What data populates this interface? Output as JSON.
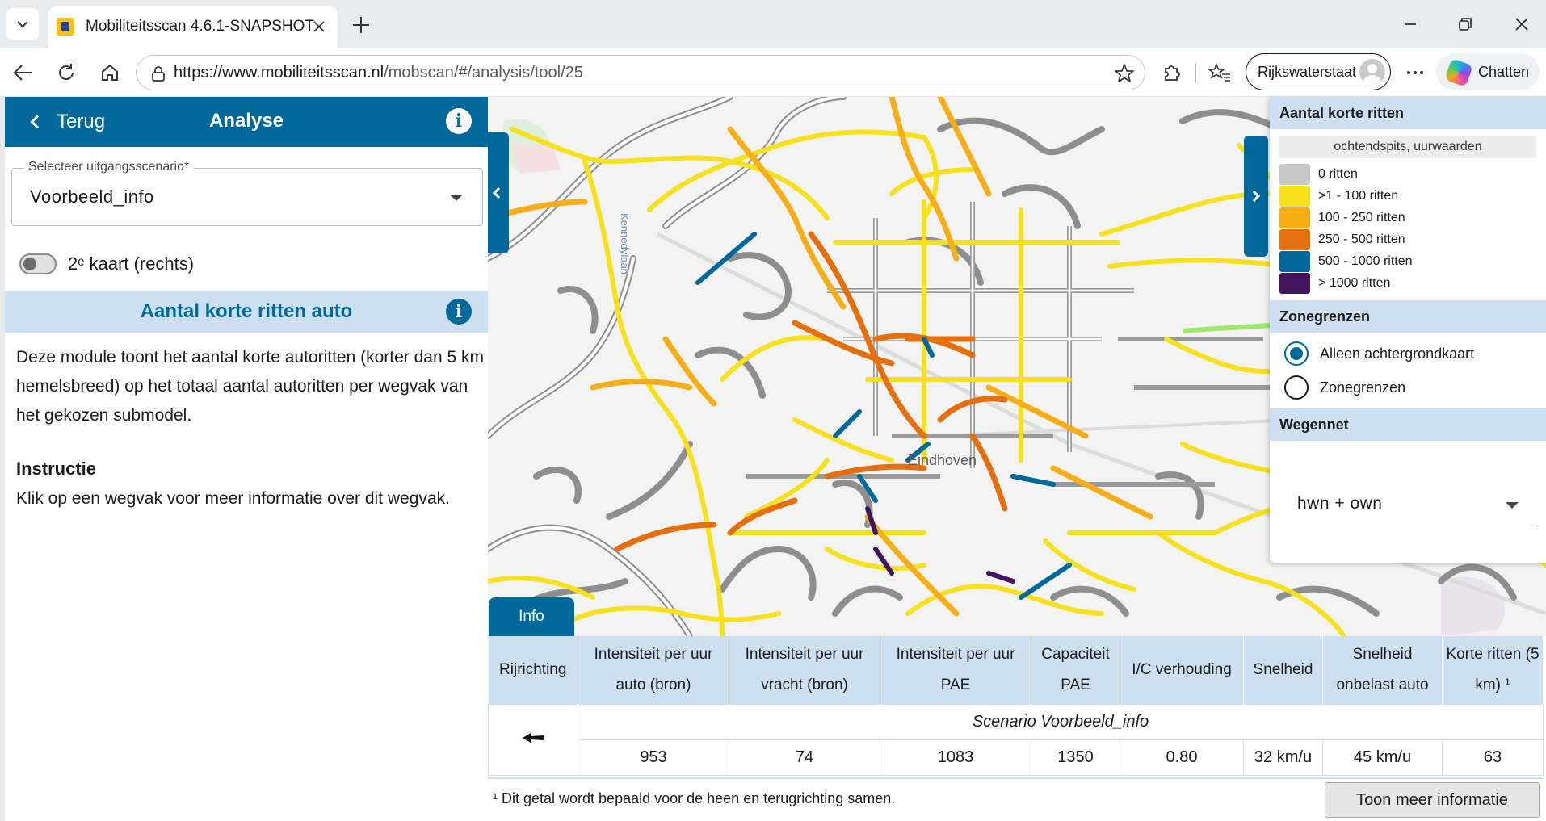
{
  "browser": {
    "tab_title": "Mobiliteitsscan 4.6.1-SNAPSHOT",
    "url_host": "https://www.mobiliteitsscan.nl",
    "url_path": "/mobscan/#/analysis/tool/25",
    "profile_name": "Rijkswaterstaat",
    "chat_label": "Chatten",
    "icons": [
      "tab-list-icon",
      "close-icon",
      "plus-icon",
      "minimize-icon",
      "restore-icon",
      "back-icon",
      "refresh-icon",
      "home-icon",
      "lock-icon",
      "star-icon",
      "extensions-icon",
      "favorites-icon",
      "more-icon",
      "copilot-icon"
    ]
  },
  "panel": {
    "back_label": "Terug",
    "title": "Analyse",
    "select_label": "Selecteer uitgangsscenario*",
    "select_value": "Voorbeeld_info",
    "toggle_label": "2ᵉ kaart (rechts)",
    "toggle_on": false,
    "module_title": "Aantal korte ritten auto",
    "description": "Deze module toont het aantal korte autoritten (korter dan 5 km hemelsbreed) op het totaal aantal autoritten per wegvak van het gekozen submodel.",
    "instruction_title": "Instructie",
    "instruction_text": "Klik op een wegvak voor meer informatie over dit wegvak."
  },
  "map": {
    "city_label": "Eindhoven",
    "road_label": "Kennedylaan",
    "info_tab": "Info"
  },
  "legend": {
    "title": "Aantal korte ritten",
    "subtitle": "ochtendspits, uurwaarden",
    "items": [
      {
        "label": "0 ritten",
        "color": "#c8c8c8"
      },
      {
        "label": ">1 - 100 ritten",
        "color": "#f7e01c"
      },
      {
        "label": "100 - 250 ritten",
        "color": "#f6ae18"
      },
      {
        "label": "250 - 500 ritten",
        "color": "#e56e0d"
      },
      {
        "label": "500 - 1000 ritten",
        "color": "#01689b"
      },
      {
        "label": "> 1000 ritten",
        "color": "#42145f"
      }
    ],
    "zone_title": "Zonegrenzen",
    "zone_options": [
      {
        "label": "Alleen achtergrondkaart",
        "selected": true
      },
      {
        "label": "Zonegrenzen",
        "selected": false
      }
    ],
    "network_title": "Wegennet",
    "network_value": "hwn + own"
  },
  "table": {
    "headers": [
      "Rijrichting",
      "Intensiteit per uur auto (bron)",
      "Intensiteit per uur vracht (bron)",
      "Intensiteit per uur PAE",
      "Capaciteit PAE",
      "I/C verhouding",
      "Snelheid",
      "Snelheid onbelast auto",
      "Korte ritten (5 km) ¹"
    ],
    "scenario_label": "Scenario Voorbeeld_info",
    "direction_icon": "arrow-left-icon",
    "values": [
      "953",
      "74",
      "1083",
      "1350",
      "0.80",
      "32 km/u",
      "45 km/u",
      "63"
    ],
    "footnote": "¹ Dit getal wordt bepaald voor de heen en terugrichting samen.",
    "more_button": "Toon meer informatie"
  },
  "colors": {
    "primary": "#01689b",
    "header_light": "#cce0f1"
  }
}
